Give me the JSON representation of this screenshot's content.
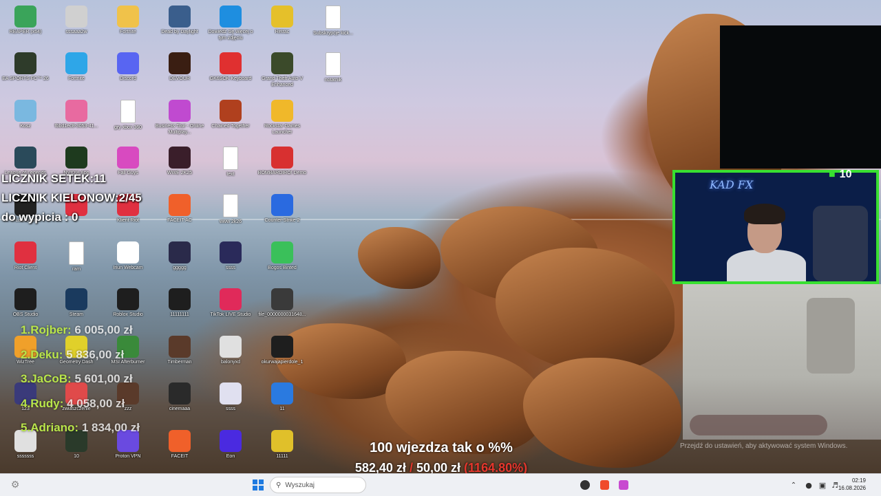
{
  "desktop_icons": [
    {
      "label": "REAPER (x64)",
      "icon": "reaper-icon",
      "color": "#3aa45a"
    },
    {
      "label": "sssaaa2w",
      "icon": "shortcut-icon",
      "color": "#d0d0d0"
    },
    {
      "label": "Fortnite",
      "icon": "folder-icon",
      "color": "#f0c24a"
    },
    {
      "label": "Dead by Daylight",
      "icon": "dbd-icon",
      "color": "#3a5e8c"
    },
    {
      "label": "Dowiedz się więcej o tym zdjęciu",
      "icon": "info-icon",
      "color": "#1e8ee0"
    },
    {
      "label": "Retrac",
      "icon": "duck-icon",
      "color": "#e5c02a"
    },
    {
      "label": "Subskrypcje kick...",
      "icon": "document-icon",
      "color": "#ffffff"
    },
    {
      "label": "EA SPORTS FC™ 26",
      "icon": "easfc-icon",
      "color": "#2e3b2a"
    },
    {
      "label": "Fortnite",
      "icon": "fortnite-icon",
      "color": "#2ea6e8"
    },
    {
      "label": "Discord",
      "icon": "discord-icon",
      "color": "#5865f2"
    },
    {
      "label": "DEVOUR",
      "icon": "devour-icon",
      "color": "#3a1e12"
    },
    {
      "label": "GK6SOK Keyboard",
      "icon": "keyboard-icon",
      "color": "#e03030"
    },
    {
      "label": "Grand Theft Auto V Enhanced",
      "icon": "gta-icon",
      "color": "#3b4a2a"
    },
    {
      "label": "notatnik",
      "icon": "document-icon",
      "color": "#ffffff"
    },
    {
      "label": "Kosz",
      "icon": "recycle-bin-icon",
      "color": "#7ab8e0"
    },
    {
      "label": "fbbd1ec8-3053-41...",
      "icon": "image-icon",
      "color": "#e86aa0"
    },
    {
      "label": "gry xbox 360",
      "icon": "document-icon",
      "color": "#ffffff"
    },
    {
      "label": "Business Tour - Online Multiplay...",
      "icon": "business-tour-icon",
      "color": "#c04ad0"
    },
    {
      "label": "Chained Together",
      "icon": "chained-icon",
      "color": "#b0401e"
    },
    {
      "label": "Rockstar Games Launcher",
      "icon": "rockstar-icon",
      "color": "#f0b82a"
    },
    {
      "label": "League of Legends",
      "icon": "lol-icon",
      "color": "#2a4a5a"
    },
    {
      "label": "NVIDIA App",
      "icon": "nvidia-icon",
      "color": "#1e3a1e"
    },
    {
      "label": "Fall Guys",
      "icon": "fallguys-icon",
      "color": "#d84ac0"
    },
    {
      "label": "WWE 2K25",
      "icon": "wwe-icon",
      "color": "#3a1e2a"
    },
    {
      "label": "text",
      "icon": "document-icon",
      "color": "#ffffff"
    },
    {
      "label": "BOMBARDIRO! Demo",
      "icon": "bombardiro-icon",
      "color": "#d83030"
    },
    {
      "label": "Launcher",
      "icon": "epic-games-icon",
      "color": "#222222"
    },
    {
      "label": "",
      "icon": "valorant-icon",
      "color": "#e03040"
    },
    {
      "label": "Klient Riot",
      "icon": "riot-icon",
      "color": "#e03040"
    },
    {
      "label": "FACEIT AC",
      "icon": "faceit-ac-icon",
      "color": "#f0602a"
    },
    {
      "label": "www 2k26",
      "icon": "document-icon",
      "color": "#ffffff"
    },
    {
      "label": "Counter-Strike 2",
      "icon": "cs2-icon",
      "color": "#2a6ae0"
    },
    {
      "label": "Riot Client",
      "icon": "riot-icon",
      "color": "#e03040"
    },
    {
      "label": "ram",
      "icon": "document-icon",
      "color": "#ffffff"
    },
    {
      "label": "Iriun Webcam",
      "icon": "webcam-icon",
      "color": "#ffffff"
    },
    {
      "label": "ggggg",
      "icon": "image-icon",
      "color": "#2a2a4a"
    },
    {
      "label": "ssss",
      "icon": "image-icon",
      "color": "#2a2a5a"
    },
    {
      "label": "Bogos Binted",
      "icon": "alien-icon",
      "color": "#3ac05a"
    },
    {
      "label": "OBS Studio",
      "icon": "obs-icon",
      "color": "#1e1e1e"
    },
    {
      "label": "Steam",
      "icon": "steam-icon",
      "color": "#1a3a5e"
    },
    {
      "label": "Roblox Studio",
      "icon": "roblox-icon",
      "color": "#1e1e1e"
    },
    {
      "label": "11111111",
      "icon": "image-icon",
      "color": "#1e1e1e"
    },
    {
      "label": "TikTok LIVE Studio",
      "icon": "tiktok-icon",
      "color": "#e02a5a"
    },
    {
      "label": "file_0000000031648...",
      "icon": "image-icon",
      "color": "#3a3a3a"
    },
    {
      "label": "WizTree",
      "icon": "wiztree-icon",
      "color": "#f0a02a"
    },
    {
      "label": "Geometry Dash",
      "icon": "geometry-dash-icon",
      "color": "#e0d02a"
    },
    {
      "label": "MSI Afterburner",
      "icon": "msi-icon",
      "color": "#3a8a3a"
    },
    {
      "label": "Timberman",
      "icon": "timberman-icon",
      "color": "#5a3a2a"
    },
    {
      "label": "balonyxd",
      "icon": "image-icon",
      "color": "#e0e0e0"
    },
    {
      "label": "okurwajapierdole_1",
      "icon": "image-icon",
      "color": "#1e1e1e"
    },
    {
      "label": "123",
      "icon": "image-icon",
      "color": "#3a3a7a"
    },
    {
      "label": "zwiaszczenie",
      "icon": "image-icon",
      "color": "#e04a4a"
    },
    {
      "label": "zzz",
      "icon": "image-icon",
      "color": "#5a3a2a"
    },
    {
      "label": "cinemaaa",
      "icon": "image-icon",
      "color": "#2a2a2a"
    },
    {
      "label": "ssss",
      "icon": "image-icon",
      "color": "#e0e0f0"
    },
    {
      "label": "11",
      "icon": "number-one-icon",
      "color": "#2a7ae0"
    },
    {
      "label": "sssssss",
      "icon": "image-icon",
      "color": "#e0e0e0"
    },
    {
      "label": "10",
      "icon": "image-icon",
      "color": "#2a3a2a"
    },
    {
      "label": "Proton VPN",
      "icon": "vpn-icon",
      "color": "#6a4ae0"
    },
    {
      "label": "FACEIT",
      "icon": "faceit-icon",
      "color": "#f0602a"
    },
    {
      "label": "Eon",
      "icon": "eon-icon",
      "color": "#4a2ae0"
    },
    {
      "label": "11111",
      "icon": "number-one-icon",
      "color": "#e0c02a"
    }
  ],
  "counters": {
    "line1": "LICZNIK SETEK:11",
    "line2": "LICZNIK KIELONOW:2/45",
    "line3": "do wypicia : 0"
  },
  "donors": [
    {
      "rank": "1.",
      "name": "Rojber:",
      "amount": "6 005,00 zł"
    },
    {
      "rank": "2.",
      "name": "Deku:",
      "amount": "5 836,00 zł"
    },
    {
      "rank": "3.",
      "name": "JaCoB:",
      "amount": "5 601,00 zł"
    },
    {
      "rank": "4.",
      "name": "Rudy:",
      "amount": "4 058,00 zł"
    },
    {
      "rank": "5.",
      "name": "Adriano:",
      "amount": "1 834,00 zł"
    }
  ],
  "goal": {
    "title": "100 wjezdza tak o %%",
    "current": "582,40 zł",
    "separator": "/",
    "target": "50,00 zł",
    "percent": "(1164.80%)"
  },
  "webcam": {
    "neon_sign": "KAD FX",
    "viewer_count": "10"
  },
  "windows_activation": "Przejdź do ustawień, aby aktywować system Windows.",
  "taskbar": {
    "search_placeholder": "Wyszukaj",
    "time": "02:19",
    "date": "16.08.2026"
  },
  "colors": {
    "overlay_green": "#38e030",
    "donor_name": "#b9e54a",
    "goal_red": "#e5362c"
  }
}
